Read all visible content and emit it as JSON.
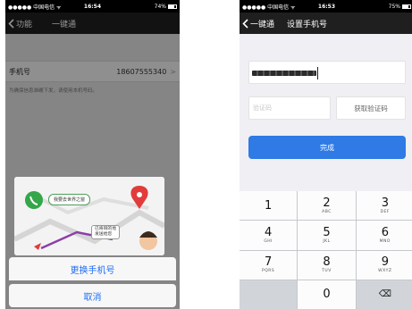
{
  "left": {
    "status": {
      "carrier": "●●●●● 中国电信 ᯤ",
      "time": "16:54",
      "battery": "74%",
      "battery_level": 0.74
    },
    "nav": {
      "back_label": "功能",
      "title": "一键通"
    },
    "row": {
      "label": "手机号",
      "value": "18607555340",
      "chevron": ">"
    },
    "hint": "为确保信息准确下发，请使用本机号码。",
    "illustration": {
      "bubble1": "我要去世界之窗",
      "bubble2": "已将目的地\n发送给您"
    },
    "sheet": {
      "change_label": "更换手机号",
      "cancel_label": "取消"
    }
  },
  "right": {
    "status": {
      "carrier": "●●●●● 中国电信 ᯤ",
      "time": "16:53",
      "battery": "75%",
      "battery_level": 0.75
    },
    "nav": {
      "back_label": "一键通",
      "title": "设置手机号"
    },
    "code_placeholder": "验证码",
    "get_code_label": "获取验证码",
    "done_label": "完成",
    "keys": [
      {
        "d": "1",
        "l": ""
      },
      {
        "d": "2",
        "l": "ABC"
      },
      {
        "d": "3",
        "l": "DEF"
      },
      {
        "d": "4",
        "l": "GHI"
      },
      {
        "d": "5",
        "l": "JKL"
      },
      {
        "d": "6",
        "l": "MNO"
      },
      {
        "d": "7",
        "l": "PQRS"
      },
      {
        "d": "8",
        "l": "TUV"
      },
      {
        "d": "9",
        "l": "WXYZ"
      },
      {
        "d": "",
        "l": ""
      },
      {
        "d": "0",
        "l": ""
      },
      {
        "d": "⌫",
        "l": ""
      }
    ]
  },
  "colors": {
    "accent": "#1e6ef5",
    "done_button": "#2f7ae5",
    "navbar": "#1f1f1f"
  }
}
